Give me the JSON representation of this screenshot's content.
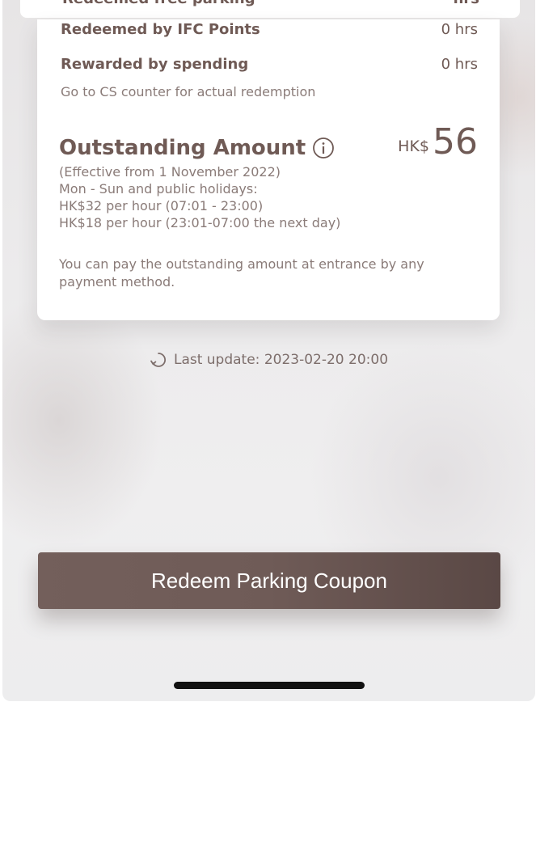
{
  "top_row": {
    "label": "Redeemed free parking",
    "value": "hrs"
  },
  "redeemed_ifc": {
    "label": "Redeemed by IFC Points",
    "value": "0 hrs"
  },
  "rewarded_spending": {
    "label": "Rewarded by spending",
    "value": "0 hrs"
  },
  "cs_note": "Go to CS counter for actual redemption",
  "outstanding": {
    "title": "Outstanding Amount",
    "currency": "HK$",
    "amount": "56"
  },
  "rates": [
    "(Effective from 1 November 2022)",
    "Mon - Sun and public holidays:",
    "HK$32 per hour (07:01 - 23:00)",
    "HK$18 per hour (23:01-07:00 the next day)"
  ],
  "pay_note": "You can pay the outstanding amount at entrance by any payment method.",
  "last_update": "Last update: 2023-02-20 20:00",
  "redeem_button_label": "Redeem Parking Coupon",
  "colors": {
    "brand": "#6f5a55",
    "button": "#6f5b57"
  },
  "icons": {
    "info": "info-icon",
    "refresh": "refresh-icon"
  }
}
